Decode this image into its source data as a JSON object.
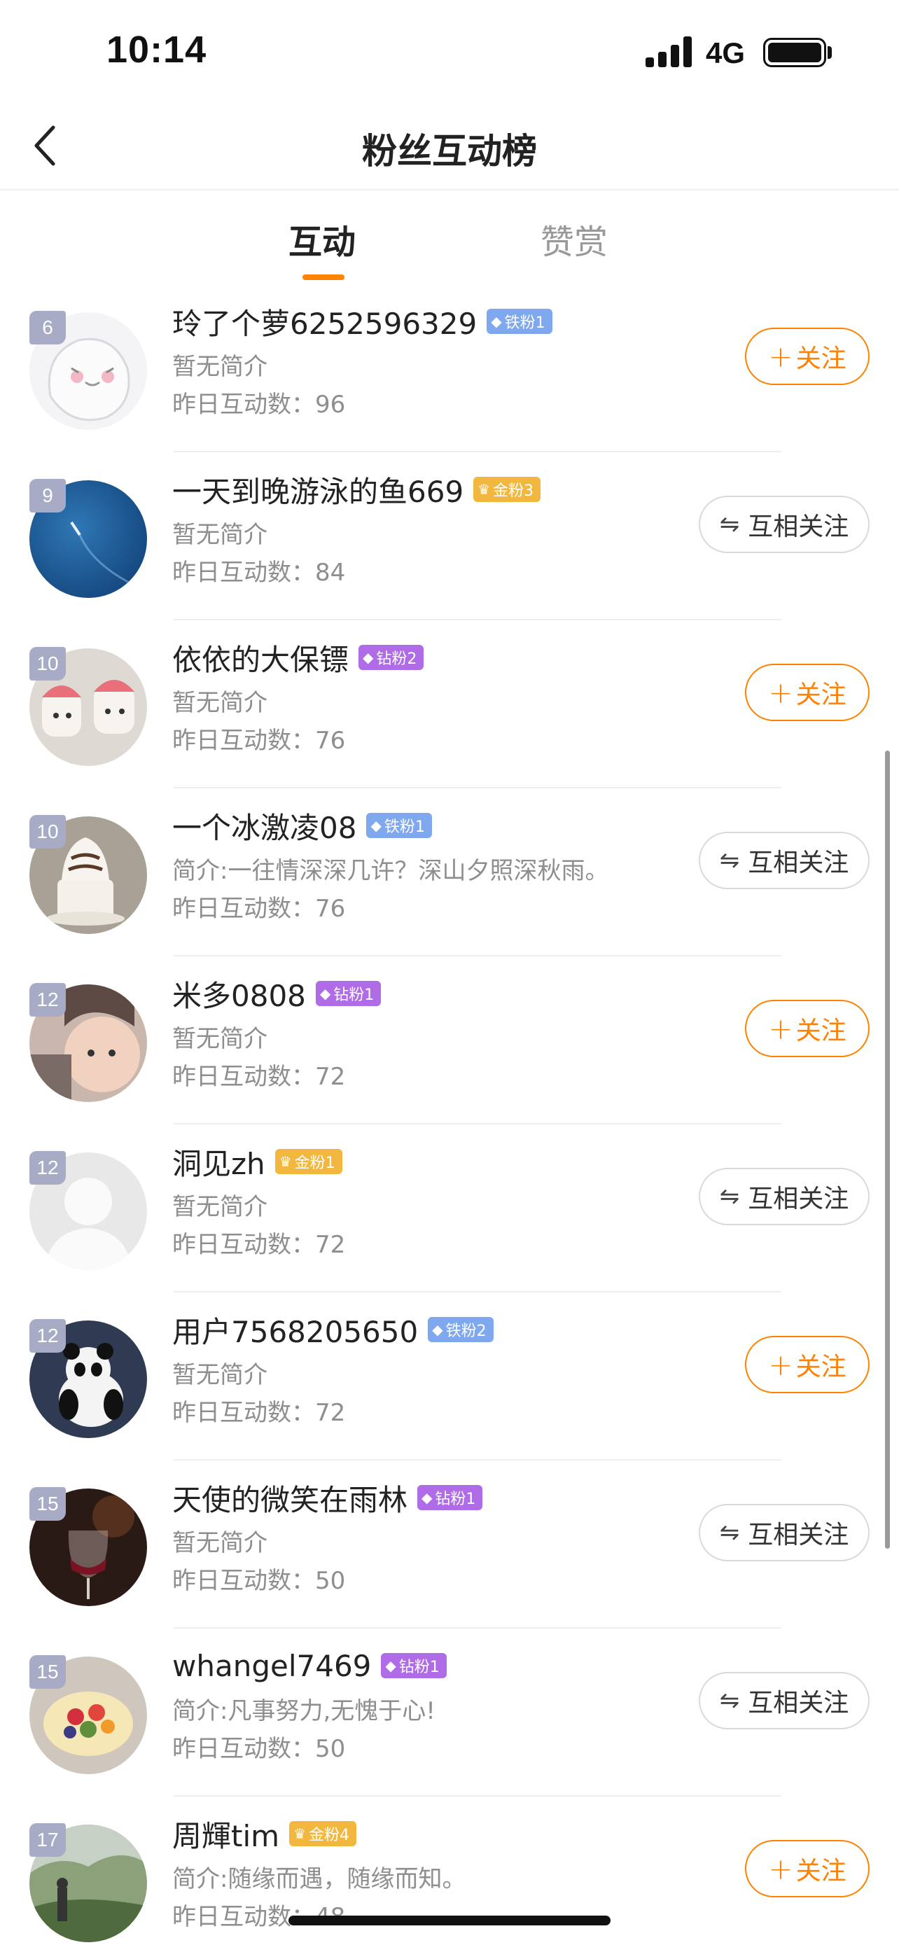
{
  "status_bar": {
    "time": "10:14",
    "network": "4G"
  },
  "nav": {
    "title": "粉丝互动榜"
  },
  "tabs": [
    {
      "label": "互动",
      "active": true
    },
    {
      "label": "赞赏",
      "active": false
    }
  ],
  "buttons": {
    "follow_label": "关注",
    "mutual_label": "互相关注"
  },
  "colors": {
    "accent": "#ff8200",
    "iron": "#7fa8ef",
    "gold": "#f2b73e",
    "diamond": "#b06be6"
  },
  "fans": [
    {
      "rank": "6",
      "name": "玲了个萝6252596329",
      "tag": "铁粉1",
      "tag_type": "iron",
      "bio": "暂无简介",
      "interactions": "昨日互动数：96",
      "action": "follow",
      "avatar": "avatar-cartoon"
    },
    {
      "rank": "9",
      "name": "一天到晚游泳的鱼669",
      "tag": "金粉3",
      "tag_type": "gold",
      "bio": "暂无简介",
      "interactions": "昨日互动数：84",
      "action": "mutual",
      "avatar": "avatar-ocean"
    },
    {
      "rank": "10",
      "name": "依依的大保镖",
      "tag": "钻粉2",
      "tag_type": "diamond",
      "bio": "暂无简介",
      "interactions": "昨日互动数：76",
      "action": "follow",
      "avatar": "avatar-toys"
    },
    {
      "rank": "10",
      "name": "一个冰激凌08",
      "tag": "铁粉1",
      "tag_type": "iron",
      "bio": "简介:一往情深深几许？深山夕照深秋雨。",
      "interactions": "昨日互动数：76",
      "action": "mutual",
      "avatar": "avatar-icecream"
    },
    {
      "rank": "12",
      "name": "米多0808",
      "tag": "钻粉1",
      "tag_type": "diamond",
      "bio": "暂无简介",
      "interactions": "昨日互动数：72",
      "action": "follow",
      "avatar": "avatar-baby"
    },
    {
      "rank": "12",
      "name": "洞见zh",
      "tag": "金粉1",
      "tag_type": "gold",
      "bio": "暂无简介",
      "interactions": "昨日互动数：72",
      "action": "mutual",
      "avatar": "avatar-default"
    },
    {
      "rank": "12",
      "name": "用户7568205650",
      "tag": "铁粉2",
      "tag_type": "iron",
      "bio": "暂无简介",
      "interactions": "昨日互动数：72",
      "action": "follow",
      "avatar": "avatar-panda"
    },
    {
      "rank": "15",
      "name": "天使的微笑在雨林",
      "tag": "钻粉1",
      "tag_type": "diamond",
      "bio": "暂无简介",
      "interactions": "昨日互动数：50",
      "action": "mutual",
      "avatar": "avatar-wine"
    },
    {
      "rank": "15",
      "name": "whangel7469",
      "tag": "钻粉1",
      "tag_type": "diamond",
      "bio": "简介:凡事努力,无愧于心!",
      "interactions": "昨日互动数：50",
      "action": "mutual",
      "avatar": "avatar-cake"
    },
    {
      "rank": "17",
      "name": "周輝tim",
      "tag": "金粉4",
      "tag_type": "gold",
      "bio": "简介:随缘而遇，随缘而知。",
      "interactions": "昨日互动数：48",
      "action": "follow",
      "avatar": "avatar-landscape"
    }
  ]
}
